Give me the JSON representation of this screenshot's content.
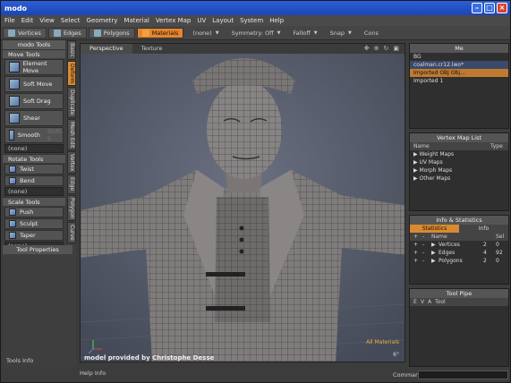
{
  "window": {
    "title": "modo"
  },
  "menu": [
    "File",
    "Edit",
    "View",
    "Select",
    "Geometry",
    "Material",
    "Vertex Map",
    "UV",
    "Layout",
    "System",
    "Help"
  ],
  "toolbar": {
    "modes": [
      {
        "label": "Vertices",
        "active": false
      },
      {
        "label": "Edges",
        "active": false
      },
      {
        "label": "Polygons",
        "active": false
      },
      {
        "label": "Materials",
        "active": true
      }
    ],
    "material_select": "(none)",
    "symmetry": "Symmetry: Off",
    "falloff": "Falloff",
    "snap": "Snap",
    "constraint": "Cons"
  },
  "left": {
    "title": "modo Tools",
    "move_tools_header": "Move Tools",
    "move_tools": [
      {
        "label": "Element Move",
        "extra": ""
      },
      {
        "label": "Soft Move",
        "extra": ""
      },
      {
        "label": "Soft Drag",
        "extra": ""
      },
      {
        "label": "Shear",
        "extra": ""
      },
      {
        "label": "Smooth",
        "extra": "Shift-S"
      }
    ],
    "move_dropdown": "(none)",
    "rotate_header": "Rotate Tools",
    "rotate_tools": [
      "Twist",
      "Bend"
    ],
    "rotate_dropdown": "(none)",
    "scale_header": "Scale Tools",
    "scale_tools": [
      "Push",
      "Sculpt",
      "Taper"
    ],
    "scale_dropdown": "(none)",
    "vtabs": [
      {
        "label": "Basic",
        "active": false
      },
      {
        "label": "Deform",
        "active": true
      },
      {
        "label": "Duplicate",
        "active": false
      },
      {
        "label": "Mesh Edit",
        "active": false
      },
      {
        "label": "Vertex",
        "active": false
      },
      {
        "label": "Edge",
        "active": false
      },
      {
        "label": "Polygon",
        "active": false
      },
      {
        "label": "Curve",
        "active": false
      }
    ],
    "tool_properties": "Tool Properties",
    "tools_info": "Tools Info"
  },
  "viewport": {
    "tabs": [
      {
        "label": "Perspective",
        "active": true
      },
      {
        "label": "Texture",
        "active": false
      }
    ],
    "caption": "model provided by Christophe Desse",
    "material_label": "All Materials",
    "degree": "6°"
  },
  "help_info": "Help Info",
  "right": {
    "mesh_panel_title": "Me",
    "mesh_items": [
      {
        "label": "BG",
        "style": ""
      },
      {
        "label": "coalman.cr12.lwo*",
        "style": "hl"
      },
      {
        "label": "Imported OBJ Obj...",
        "style": "sel"
      },
      {
        "label": "Imported 1",
        "style": ""
      }
    ],
    "vmap_title": "Vertex Map List",
    "vmap_cols": [
      "Name",
      "Type"
    ],
    "vmap_items": [
      "Weight Maps",
      "UV Maps",
      "Morph Maps",
      "Other Maps"
    ],
    "info_title": "Info & Statistics",
    "info_tabs": [
      {
        "label": "Statistics",
        "active": true
      },
      {
        "label": "Info",
        "active": false
      }
    ],
    "stats_cols": [
      "+",
      "-",
      "Name",
      "Sel"
    ],
    "stats_items": [
      {
        "label": "Vertices",
        "value": "2",
        "count": "0"
      },
      {
        "label": "Edges",
        "value": "4",
        "count": "92"
      },
      {
        "label": "Polygons",
        "value": "2",
        "count": "0"
      }
    ],
    "toolpipe_title": "Tool Pipe",
    "toolpipe_cols": [
      "E",
      "V",
      "A",
      "Tool"
    ],
    "command_label": "Command"
  }
}
